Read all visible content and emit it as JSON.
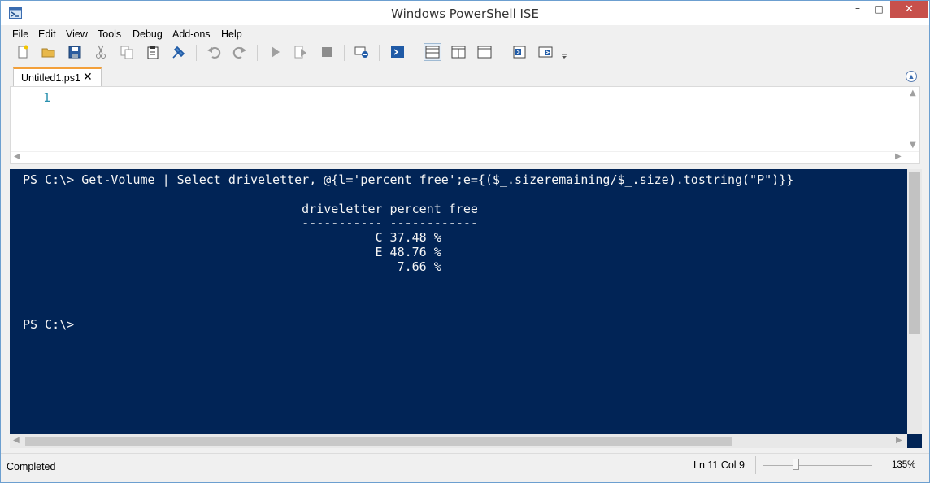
{
  "window": {
    "title": "Windows PowerShell ISE"
  },
  "titlebar_buttons": {
    "minimize": "–",
    "maximize": "□",
    "close": "✕"
  },
  "menu": [
    "File",
    "Edit",
    "View",
    "Tools",
    "Debug",
    "Add-ons",
    "Help"
  ],
  "toolbar_icons": [
    "new-icon",
    "open-icon",
    "save-icon",
    "cut-icon",
    "copy-icon",
    "paste-icon",
    "clear-console-icon",
    "undo-icon",
    "redo-icon",
    "run-script-icon",
    "run-selection-icon",
    "stop-icon",
    "new-remote-tab-icon",
    "start-powershell-icon",
    "show-script-top-icon",
    "show-script-right-icon",
    "show-script-maximized-icon",
    "show-command-pane-icon",
    "show-command-addon-icon"
  ],
  "tabs": [
    {
      "label": "Untitled1.ps1",
      "close": "✕"
    }
  ],
  "editor": {
    "line_numbers": [
      "1"
    ]
  },
  "console": {
    "command_line": "PS C:\\> Get-Volume | Select driveletter, @{l='percent free';e={($_.sizeremaining/$_.size).tostring(\"P\")}}",
    "table": {
      "headers": [
        "driveletter",
        "percent free"
      ],
      "rows": [
        {
          "driveletter": "C",
          "percent_free": "37.48 %"
        },
        {
          "driveletter": "E",
          "percent_free": "48.76 %"
        },
        {
          "driveletter": "",
          "percent_free": "7.66 %"
        }
      ]
    },
    "prompt": "PS C:\\>"
  },
  "status": {
    "text": "Completed",
    "line_col": "Ln 11  Col 9",
    "zoom": "135%",
    "zoom_level_fraction": 0.3
  },
  "colors": {
    "console_bg": "#012456",
    "console_fg": "#f5f5f5",
    "tab_accent": "#f3a03a",
    "close_button": "#c7504b",
    "line_number": "#2b91af"
  }
}
